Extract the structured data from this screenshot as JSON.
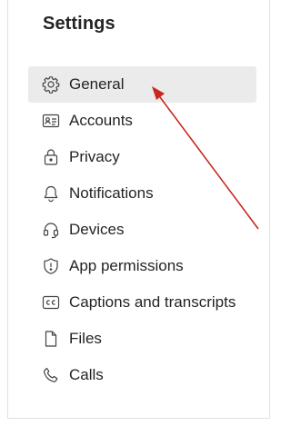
{
  "settings": {
    "title": "Settings",
    "items": [
      {
        "label": "General",
        "icon": "gear-icon",
        "selected": true
      },
      {
        "label": "Accounts",
        "icon": "id-card-icon"
      },
      {
        "label": "Privacy",
        "icon": "lock-icon"
      },
      {
        "label": "Notifications",
        "icon": "bell-icon"
      },
      {
        "label": "Devices",
        "icon": "headset-icon"
      },
      {
        "label": "App permissions",
        "icon": "shield-icon"
      },
      {
        "label": "Captions and transcripts",
        "icon": "closed-captions-icon"
      },
      {
        "label": "Files",
        "icon": "file-icon"
      },
      {
        "label": "Calls",
        "icon": "phone-icon"
      }
    ]
  },
  "colors": {
    "text": "#242424",
    "selected_background": "#ebebeb",
    "annotation_arrow": "#c8281e"
  }
}
